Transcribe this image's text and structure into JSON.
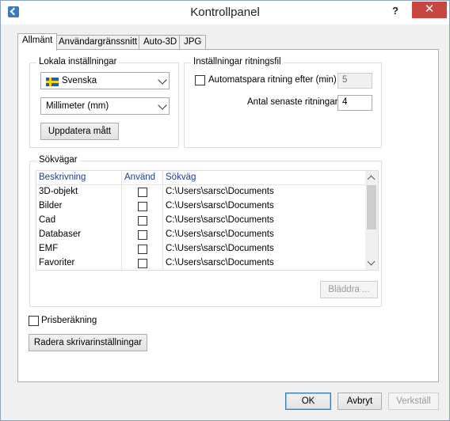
{
  "window": {
    "title": "Kontrollpanel",
    "help_label": "?",
    "close_label": "✕"
  },
  "tabs": [
    {
      "label": "Allmänt",
      "active": true
    },
    {
      "label": "Användargränssnitt",
      "active": false
    },
    {
      "label": "Auto-3D",
      "active": false
    },
    {
      "label": "JPG",
      "active": false
    }
  ],
  "local_settings": {
    "title": "Lokala inställningar",
    "language": "Svenska",
    "unit": "Millimeter (mm)",
    "update_button": "Uppdatera mått"
  },
  "drawing_file_settings": {
    "title": "Inställningar ritningsfil",
    "autosave_label": "Automatspara ritning efter (min)",
    "autosave_checked": false,
    "autosave_value": "5",
    "recent_label": "Antal senaste ritningar",
    "recent_value": "4"
  },
  "paths": {
    "title": "Sökvägar",
    "columns": [
      "Beskrivning",
      "Använd",
      "Sökväg"
    ],
    "rows": [
      {
        "description": "3D-objekt",
        "used": false,
        "path": "C:\\Users\\sarsc\\Documents"
      },
      {
        "description": "Bilder",
        "used": false,
        "path": "C:\\Users\\sarsc\\Documents"
      },
      {
        "description": "Cad",
        "used": false,
        "path": "C:\\Users\\sarsc\\Documents"
      },
      {
        "description": "Databaser",
        "used": false,
        "path": "C:\\Users\\sarsc\\Documents"
      },
      {
        "description": "EMF",
        "used": false,
        "path": "C:\\Users\\sarsc\\Documents"
      },
      {
        "description": "Favoriter",
        "used": false,
        "path": "C:\\Users\\sarsc\\Documents"
      }
    ],
    "browse_button": "Bläddra ..."
  },
  "price_calc": {
    "label": "Prisberäkning",
    "checked": false
  },
  "clear_printer_button": "Radera skrivarinställningar",
  "footer": {
    "ok": "OK",
    "cancel": "Avbryt",
    "apply": "Verkställ"
  }
}
